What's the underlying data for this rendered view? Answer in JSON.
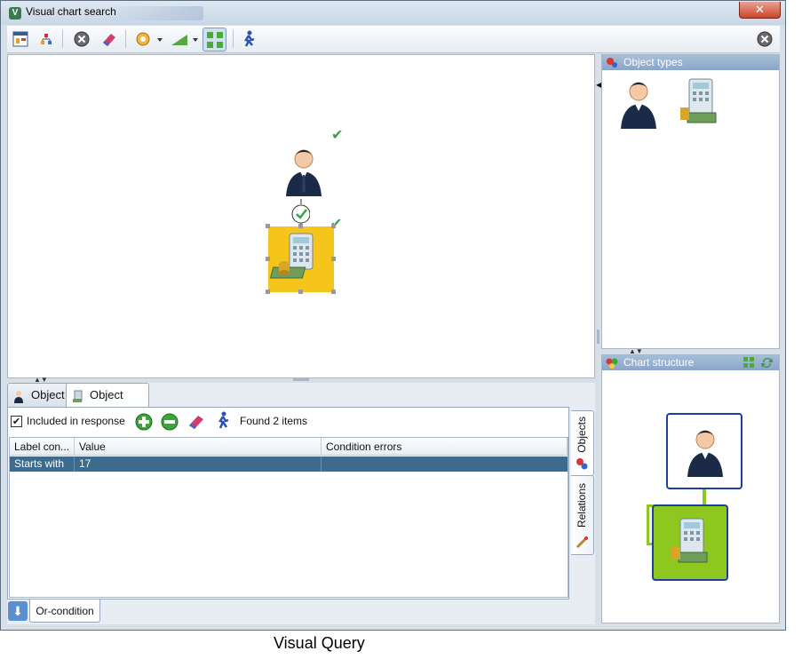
{
  "window": {
    "title": "Visual chart search",
    "close_glyph": "✕"
  },
  "toolbar": {
    "icons": [
      "layout-icon",
      "tree-icon",
      "clear-icon",
      "eraser-icon",
      "filter-icon",
      "zoom-icon",
      "fit-icon",
      "run-icon"
    ],
    "close_icon": "close-icon"
  },
  "right_panels": {
    "object_types": "Object types",
    "chart_structure": "Chart structure"
  },
  "tabs": {
    "tab1": "Object",
    "tab2": "Object"
  },
  "filter_bar": {
    "included_label": "Included in response",
    "included_checked": true,
    "found": "Found 2 items"
  },
  "grid": {
    "columns": [
      "Label con...",
      "Value",
      "Condition errors"
    ],
    "rows": [
      [
        "Starts with",
        "17",
        ""
      ]
    ]
  },
  "side_tabs": {
    "objects": "Objects",
    "relations": "Relations"
  },
  "or_condition": "Or-condition",
  "caption": "Visual Query",
  "colors": {
    "selection_orange": "#f6c51c",
    "structure_green": "#8ec71e",
    "row_selected": "#3d6b8e",
    "frame_blue": "#203f9c"
  }
}
